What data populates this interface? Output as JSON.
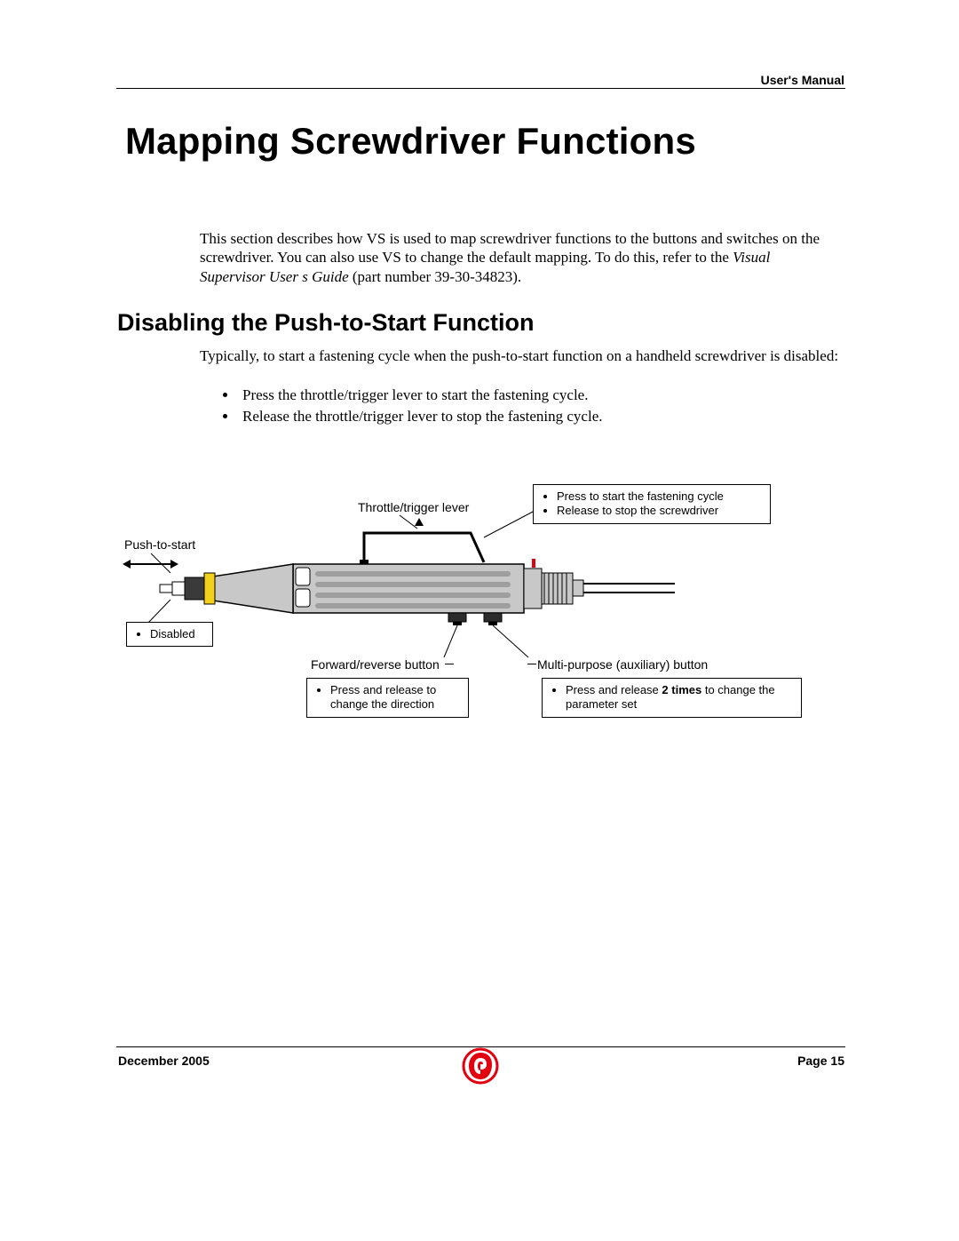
{
  "header": {
    "label": "User's Manual"
  },
  "title": "Mapping Screwdriver Functions",
  "intro": {
    "part1": "This section describes how VS is used to map screwdriver functions to the buttons and switches on the screwdriver. You can also use VS to change the default mapping. To do this, refer to the ",
    "italic": "Visual Supervisor User s Guide",
    "part2": " (part number 39-30-34823)."
  },
  "h2": "Disabling the Push-to-Start Function",
  "body1": "Typically, to start a fastening cycle when the push-to-start function on a handheld screwdriver is disabled:",
  "bullets": [
    "Press the throttle/trigger lever to start the fastening cycle.",
    "Release the throttle/trigger lever to stop the fastening cycle."
  ],
  "diagram": {
    "push_label": "Push-to-start",
    "push_box": "Disabled",
    "throttle_label": "Throttle/trigger lever",
    "throttle_box": [
      "Press to start the fastening cycle",
      "Release to stop the screwdriver"
    ],
    "fwd_label": "Forward/reverse button",
    "fwd_box": [
      "Press and release to change the direction"
    ],
    "aux_label": "Multi-purpose (auxiliary) button",
    "aux_box_pre": "Press and release ",
    "aux_box_bold": "2 times",
    "aux_box_post": " to change the parameter set"
  },
  "footer": {
    "date": "December 2005",
    "page": "Page 15"
  }
}
